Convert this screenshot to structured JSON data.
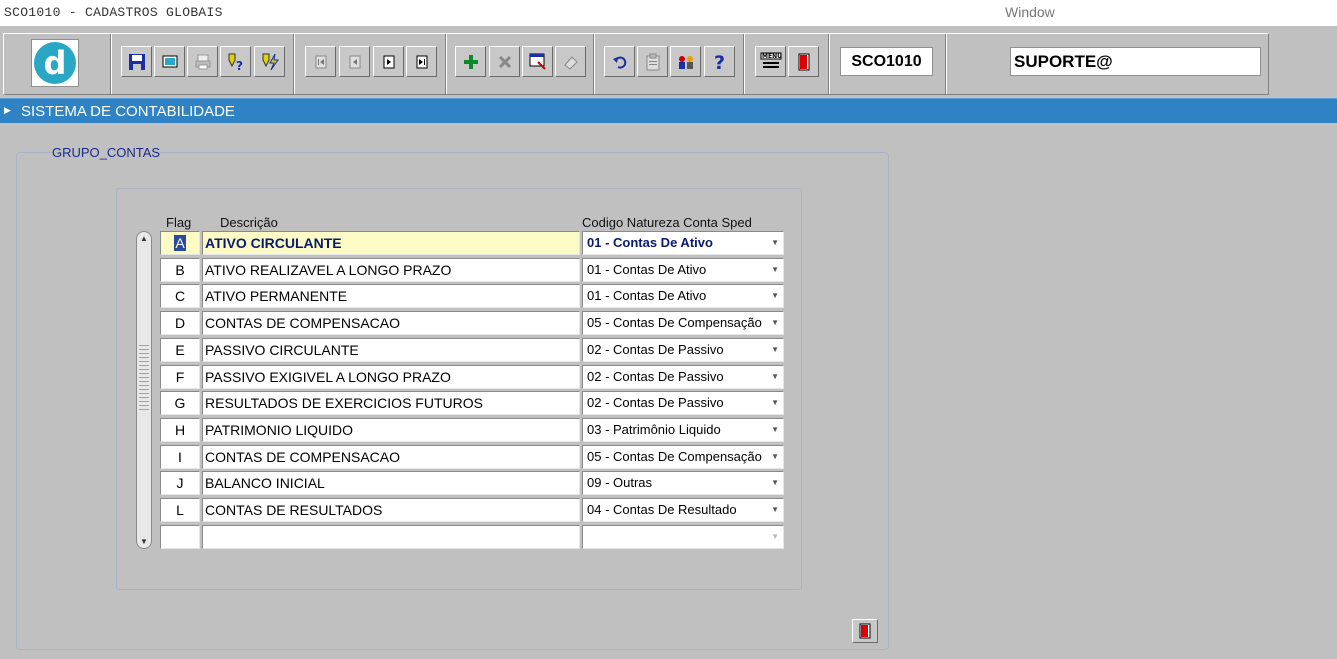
{
  "window": {
    "title": "SCO1010 - CADASTROS GLOBAIS",
    "menu_window": "Window"
  },
  "toolbar": {
    "logo_letter": "d",
    "buttons": [
      {
        "name": "save",
        "icon": "floppy-disk-icon"
      },
      {
        "name": "screen",
        "icon": "monitor-icon"
      },
      {
        "name": "print",
        "icon": "printer-icon"
      },
      {
        "name": "query-help",
        "icon": "query-question-icon"
      },
      {
        "name": "execute-query",
        "icon": "lightning-query-icon"
      },
      {
        "name": "first-record",
        "icon": "first-record-icon"
      },
      {
        "name": "previous-record",
        "icon": "previous-record-icon"
      },
      {
        "name": "next-record",
        "icon": "next-record-icon"
      },
      {
        "name": "last-record",
        "icon": "last-record-icon"
      },
      {
        "name": "insert-record",
        "icon": "plus-icon"
      },
      {
        "name": "delete-record",
        "icon": "x-icon"
      },
      {
        "name": "edit-record",
        "icon": "edit-window-icon"
      },
      {
        "name": "clear",
        "icon": "eraser-icon"
      },
      {
        "name": "undo",
        "icon": "undo-icon"
      },
      {
        "name": "clipboard",
        "icon": "clipboard-icon"
      },
      {
        "name": "users",
        "icon": "users-icon"
      },
      {
        "name": "help",
        "icon": "question-icon"
      },
      {
        "name": "menu",
        "icon": "menu-list-icon"
      },
      {
        "name": "exit",
        "icon": "exit-door-icon"
      }
    ],
    "program_code": "SCO1010",
    "user": "SUPORTE@"
  },
  "banner": {
    "title": "SISTEMA DE CONTABILIDADE"
  },
  "form": {
    "group_title": "GRUPO_CONTAS",
    "headers": {
      "flag": "Flag",
      "descricao": "Descrição",
      "natureza": "Codigo Natureza Conta Sped"
    },
    "rows": [
      {
        "flag": "A",
        "descricao": "ATIVO CIRCULANTE",
        "natureza": "01 - Contas De Ativo"
      },
      {
        "flag": "B",
        "descricao": "ATIVO REALIZAVEL A LONGO PRAZO",
        "natureza": "01 - Contas De Ativo"
      },
      {
        "flag": "C",
        "descricao": "ATIVO PERMANENTE",
        "natureza": "01 - Contas De Ativo"
      },
      {
        "flag": "D",
        "descricao": "CONTAS DE COMPENSACAO",
        "natureza": "05 - Contas De Compensação"
      },
      {
        "flag": "E",
        "descricao": "PASSIVO CIRCULANTE",
        "natureza": "02 - Contas De Passivo"
      },
      {
        "flag": "F",
        "descricao": "PASSIVO EXIGIVEL A LONGO PRAZO",
        "natureza": "02 - Contas De Passivo"
      },
      {
        "flag": "G",
        "descricao": "RESULTADOS DE EXERCICIOS FUTUROS",
        "natureza": "02 - Contas De Passivo"
      },
      {
        "flag": "H",
        "descricao": "PATRIMONIO LIQUIDO",
        "natureza": "03 - Patrimônio Liquido"
      },
      {
        "flag": "I",
        "descricao": "CONTAS DE COMPENSACAO",
        "natureza": "05 - Contas De Compensação"
      },
      {
        "flag": "J",
        "descricao": "BALANCO INICIAL",
        "natureza": "09 - Outras"
      },
      {
        "flag": "L",
        "descricao": "CONTAS DE RESULTADOS",
        "natureza": "04 - Contas De Resultado"
      },
      {
        "flag": "",
        "descricao": "",
        "natureza": ""
      }
    ],
    "active_row": 0
  },
  "colors": {
    "banner": "#2f82c4",
    "active_row": "#fcfbc6",
    "legend_text": "#1a2a8c"
  }
}
